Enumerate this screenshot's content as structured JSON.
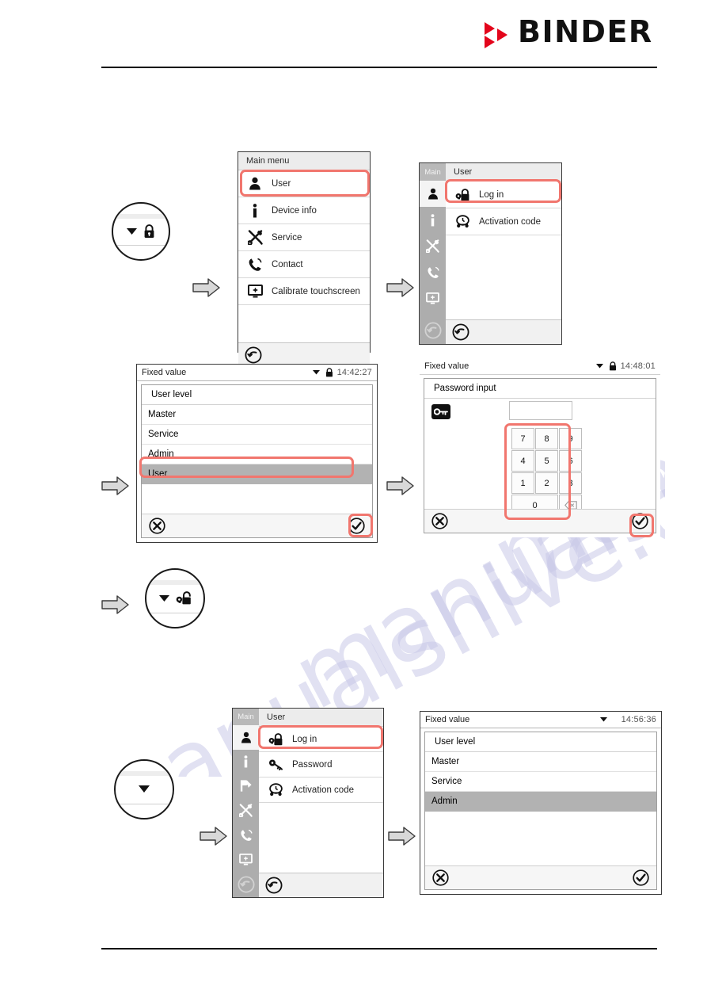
{
  "header": {
    "brand": "BINDER",
    "logo_triangle_color": "#e3051b"
  },
  "colors": {
    "highlight": "#f1766e",
    "selected_row": "#b2b2b2",
    "sidebar": "#adadad"
  },
  "panels": {
    "main_menu": {
      "title": "Main menu",
      "items": [
        {
          "label": "User",
          "icon": "user-icon",
          "highlighted": true
        },
        {
          "label": "Device info",
          "icon": "info-icon"
        },
        {
          "label": "Service",
          "icon": "tools-icon"
        },
        {
          "label": "Contact",
          "icon": "phone-icon"
        },
        {
          "label": "Calibrate touchscreen",
          "icon": "monitor-icon"
        }
      ],
      "footer_icon": "back-arrow-icon"
    },
    "user_menu_top": {
      "sidebar_title": "Main",
      "sidebar_icons": [
        "user-icon",
        "info-icon",
        "tools-icon",
        "phone-icon",
        "monitor-icon"
      ],
      "title": "User",
      "items": [
        {
          "label": "Log in",
          "icon": "login-lock-icon",
          "highlighted": true
        },
        {
          "label": "Activation code",
          "icon": "activation-code-icon"
        }
      ],
      "footer_icon": "back-arrow-icon"
    },
    "user_level_select": {
      "titlebar": {
        "title": "Fixed value",
        "lock": "locked-icon",
        "time": "14:42:27"
      },
      "list_header": "User level",
      "rows": [
        "Master",
        "Service",
        "Admin",
        "User"
      ],
      "selected_row": "User",
      "cancel_icon": "cancel-icon",
      "confirm_icon": "confirm-icon"
    },
    "password_input": {
      "titlebar": {
        "title": "Fixed value",
        "lock": "locked-icon",
        "time": "14:48:01"
      },
      "list_header": "Password input",
      "field_value": "",
      "field_placeholder": "",
      "key_icon": "key-icon",
      "keys": [
        "7",
        "8",
        "9",
        "4",
        "5",
        "6",
        "1",
        "2",
        "3",
        "0"
      ],
      "backspace_label": "⌫",
      "cancel_icon": "cancel-icon",
      "confirm_icon": "confirm-icon"
    },
    "user_menu_bottom": {
      "sidebar_title": "Main",
      "sidebar_icons": [
        "user-icon",
        "info-icon",
        "program-icon",
        "tools-icon",
        "phone-icon",
        "monitor-icon"
      ],
      "title": "User",
      "items": [
        {
          "label": "Log in",
          "icon": "login-lock-icon",
          "highlighted": true
        },
        {
          "label": "Password",
          "icon": "password-key-icon"
        },
        {
          "label": "Activation code",
          "icon": "activation-code-icon"
        }
      ],
      "footer_icon": "back-arrow-icon"
    },
    "user_level_admin": {
      "titlebar": {
        "title": "Fixed value",
        "lock": "",
        "time": "14:56:36"
      },
      "list_header": "User level",
      "rows": [
        "Master",
        "Service",
        "Admin"
      ],
      "selected_row": "Admin",
      "cancel_icon": "cancel-icon",
      "confirm_icon": "confirm-icon"
    }
  },
  "badges": [
    {
      "name": "status-locked-badge",
      "icons": [
        "chevron-down-icon",
        "locked-icon"
      ]
    },
    {
      "name": "status-unlocked-badge",
      "icons": [
        "chevron-down-icon",
        "unlocked-key-icon"
      ]
    },
    {
      "name": "status-plain-badge",
      "icons": [
        "chevron-down-icon"
      ]
    }
  ],
  "flow_arrows": [
    {
      "name": "flow-arrow-1"
    },
    {
      "name": "flow-arrow-2"
    },
    {
      "name": "flow-arrow-3"
    },
    {
      "name": "flow-arrow-4"
    },
    {
      "name": "flow-arrow-5"
    },
    {
      "name": "flow-arrow-6"
    },
    {
      "name": "flow-arrow-7"
    }
  ],
  "watermark": {
    "line1": "manualshive.com",
    "line2": "manualshive.com",
    "line3": "manualshive.com"
  }
}
